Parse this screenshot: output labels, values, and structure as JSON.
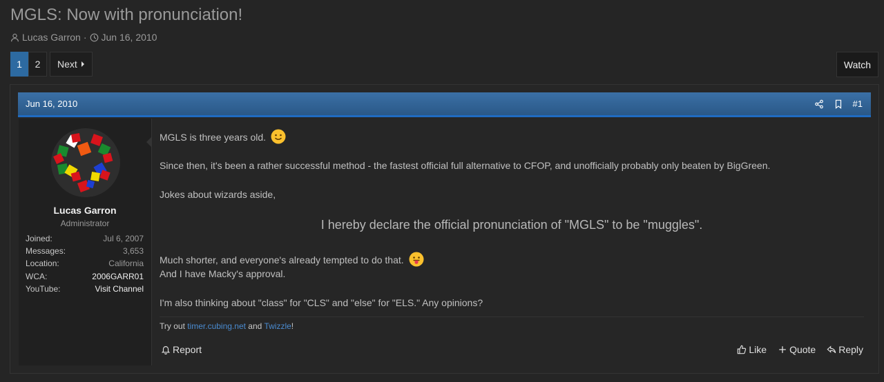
{
  "thread": {
    "title": "MGLS: Now with pronunciation!",
    "author": "Lucas Garron",
    "separator": "·",
    "date": "Jun 16, 2010"
  },
  "pagination": {
    "pages": [
      "1",
      "2"
    ],
    "current": "1",
    "next_label": "Next",
    "watch_label": "Watch"
  },
  "post": {
    "date": "Jun 16, 2010",
    "number": "#1",
    "user": {
      "name": "Lucas Garron",
      "title": "Administrator",
      "stats": [
        {
          "key": "Joined:",
          "value": "Jul 6, 2007"
        },
        {
          "key": "Messages:",
          "value": "3,653"
        },
        {
          "key": "Location:",
          "value": "California"
        },
        {
          "key": "WCA:",
          "value": "2006GARR01"
        },
        {
          "key": "YouTube:",
          "value": "Visit Channel"
        }
      ]
    },
    "body": {
      "p1": "MGLS is three years old.",
      "p2": "Since then, it's been a rather successful method - the fastest official full alternative to CFOP, and unofficially probably only beaten by BigGreen.",
      "p3": "Jokes about wizards aside,",
      "declaration": "I hereby declare the official pronunciation of \"MGLS\" to be \"muggles\".",
      "p4": "Much shorter, and everyone's already tempted to do that.",
      "p5": "And I have Macky's approval.",
      "p6": "I'm also thinking about \"class\" for \"CLS\" and \"else\" for \"ELS.\" Any opinions?"
    },
    "signature": {
      "prefix": "Try out ",
      "link1": "timer.cubing.net",
      "middle": " and ",
      "link2": "Twizzle",
      "suffix": "!"
    },
    "actions": {
      "report": "Report",
      "like": "Like",
      "quote": "Quote",
      "reply": "Reply"
    }
  },
  "colors": {
    "accent": "#2d6aa1",
    "link": "#4a8bd0",
    "background": "#252525"
  }
}
